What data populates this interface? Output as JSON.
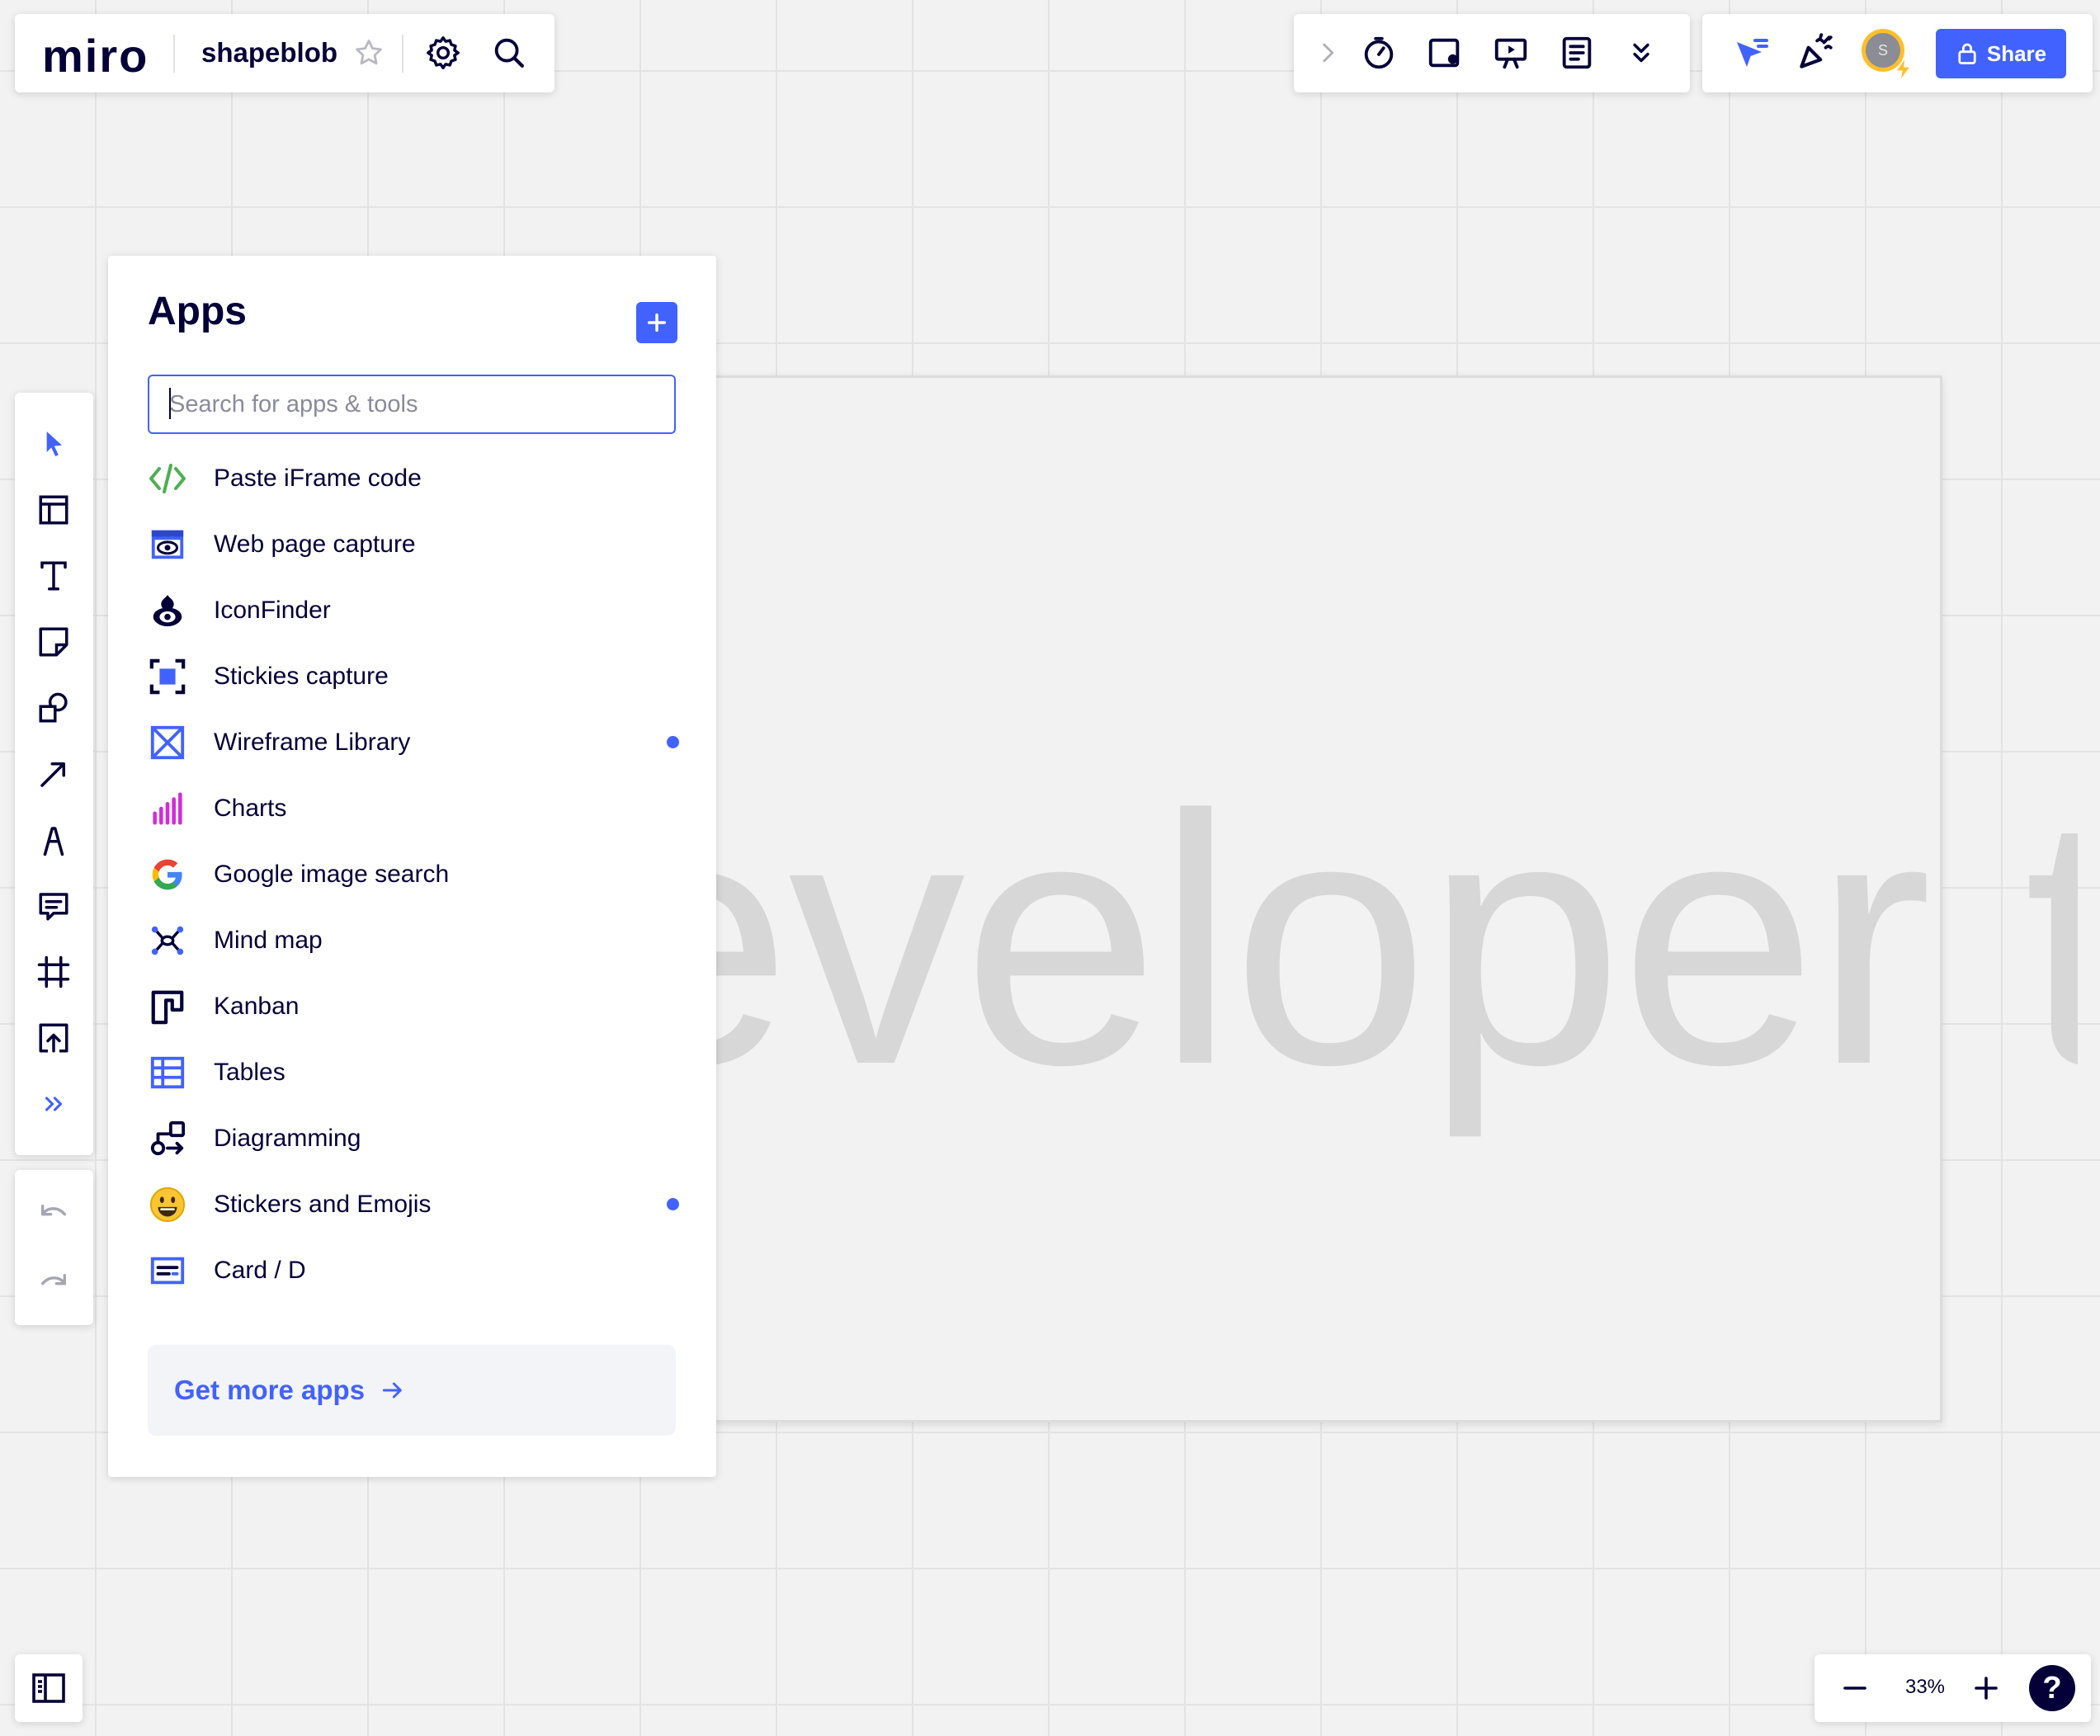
{
  "app": {
    "logo": "miro",
    "board_name": "shapeblob"
  },
  "canvas": {
    "text": "eveloper t"
  },
  "topbar_tools": {
    "icons": [
      "chevron-right-icon",
      "timer-icon",
      "card-frame-icon",
      "presentation-icon",
      "notes-icon",
      "double-chevron-down-icon"
    ]
  },
  "collab": {
    "avatar_initial": "S",
    "share_label": "Share"
  },
  "left_toolbar": {
    "tools": [
      "select",
      "templates",
      "text",
      "sticky-note",
      "shapes",
      "connection-line",
      "pen",
      "comment",
      "frame",
      "upload",
      "more"
    ]
  },
  "apps_panel": {
    "title": "Apps",
    "search_placeholder": "Search for apps & tools",
    "items": [
      {
        "label": "Paste iFrame code",
        "icon": "code-icon",
        "dot": false
      },
      {
        "label": "Web page capture",
        "icon": "web-capture-icon",
        "dot": false
      },
      {
        "label": "IconFinder",
        "icon": "iconfinder-icon",
        "dot": false
      },
      {
        "label": "Stickies capture",
        "icon": "stickies-capture-icon",
        "dot": false
      },
      {
        "label": "Wireframe Library",
        "icon": "wireframe-icon",
        "dot": true
      },
      {
        "label": "Charts",
        "icon": "charts-icon",
        "dot": false
      },
      {
        "label": "Google image search",
        "icon": "google-icon",
        "dot": false
      },
      {
        "label": "Mind map",
        "icon": "mind-map-icon",
        "dot": false
      },
      {
        "label": "Kanban",
        "icon": "kanban-icon",
        "dot": false
      },
      {
        "label": "Tables",
        "icon": "tables-icon",
        "dot": false
      },
      {
        "label": "Diagramming",
        "icon": "diagramming-icon",
        "dot": false
      },
      {
        "label": "Stickers and Emojis",
        "icon": "emoji-icon",
        "dot": true
      },
      {
        "label": "Card / D",
        "icon": "card-icon",
        "dot": false
      }
    ],
    "more_label": "Get more apps"
  },
  "zoom": {
    "value": "33%",
    "help": "?"
  },
  "colors": {
    "accent": "#4262ff",
    "ink": "#050038",
    "canvas": "#f2f2f2"
  }
}
